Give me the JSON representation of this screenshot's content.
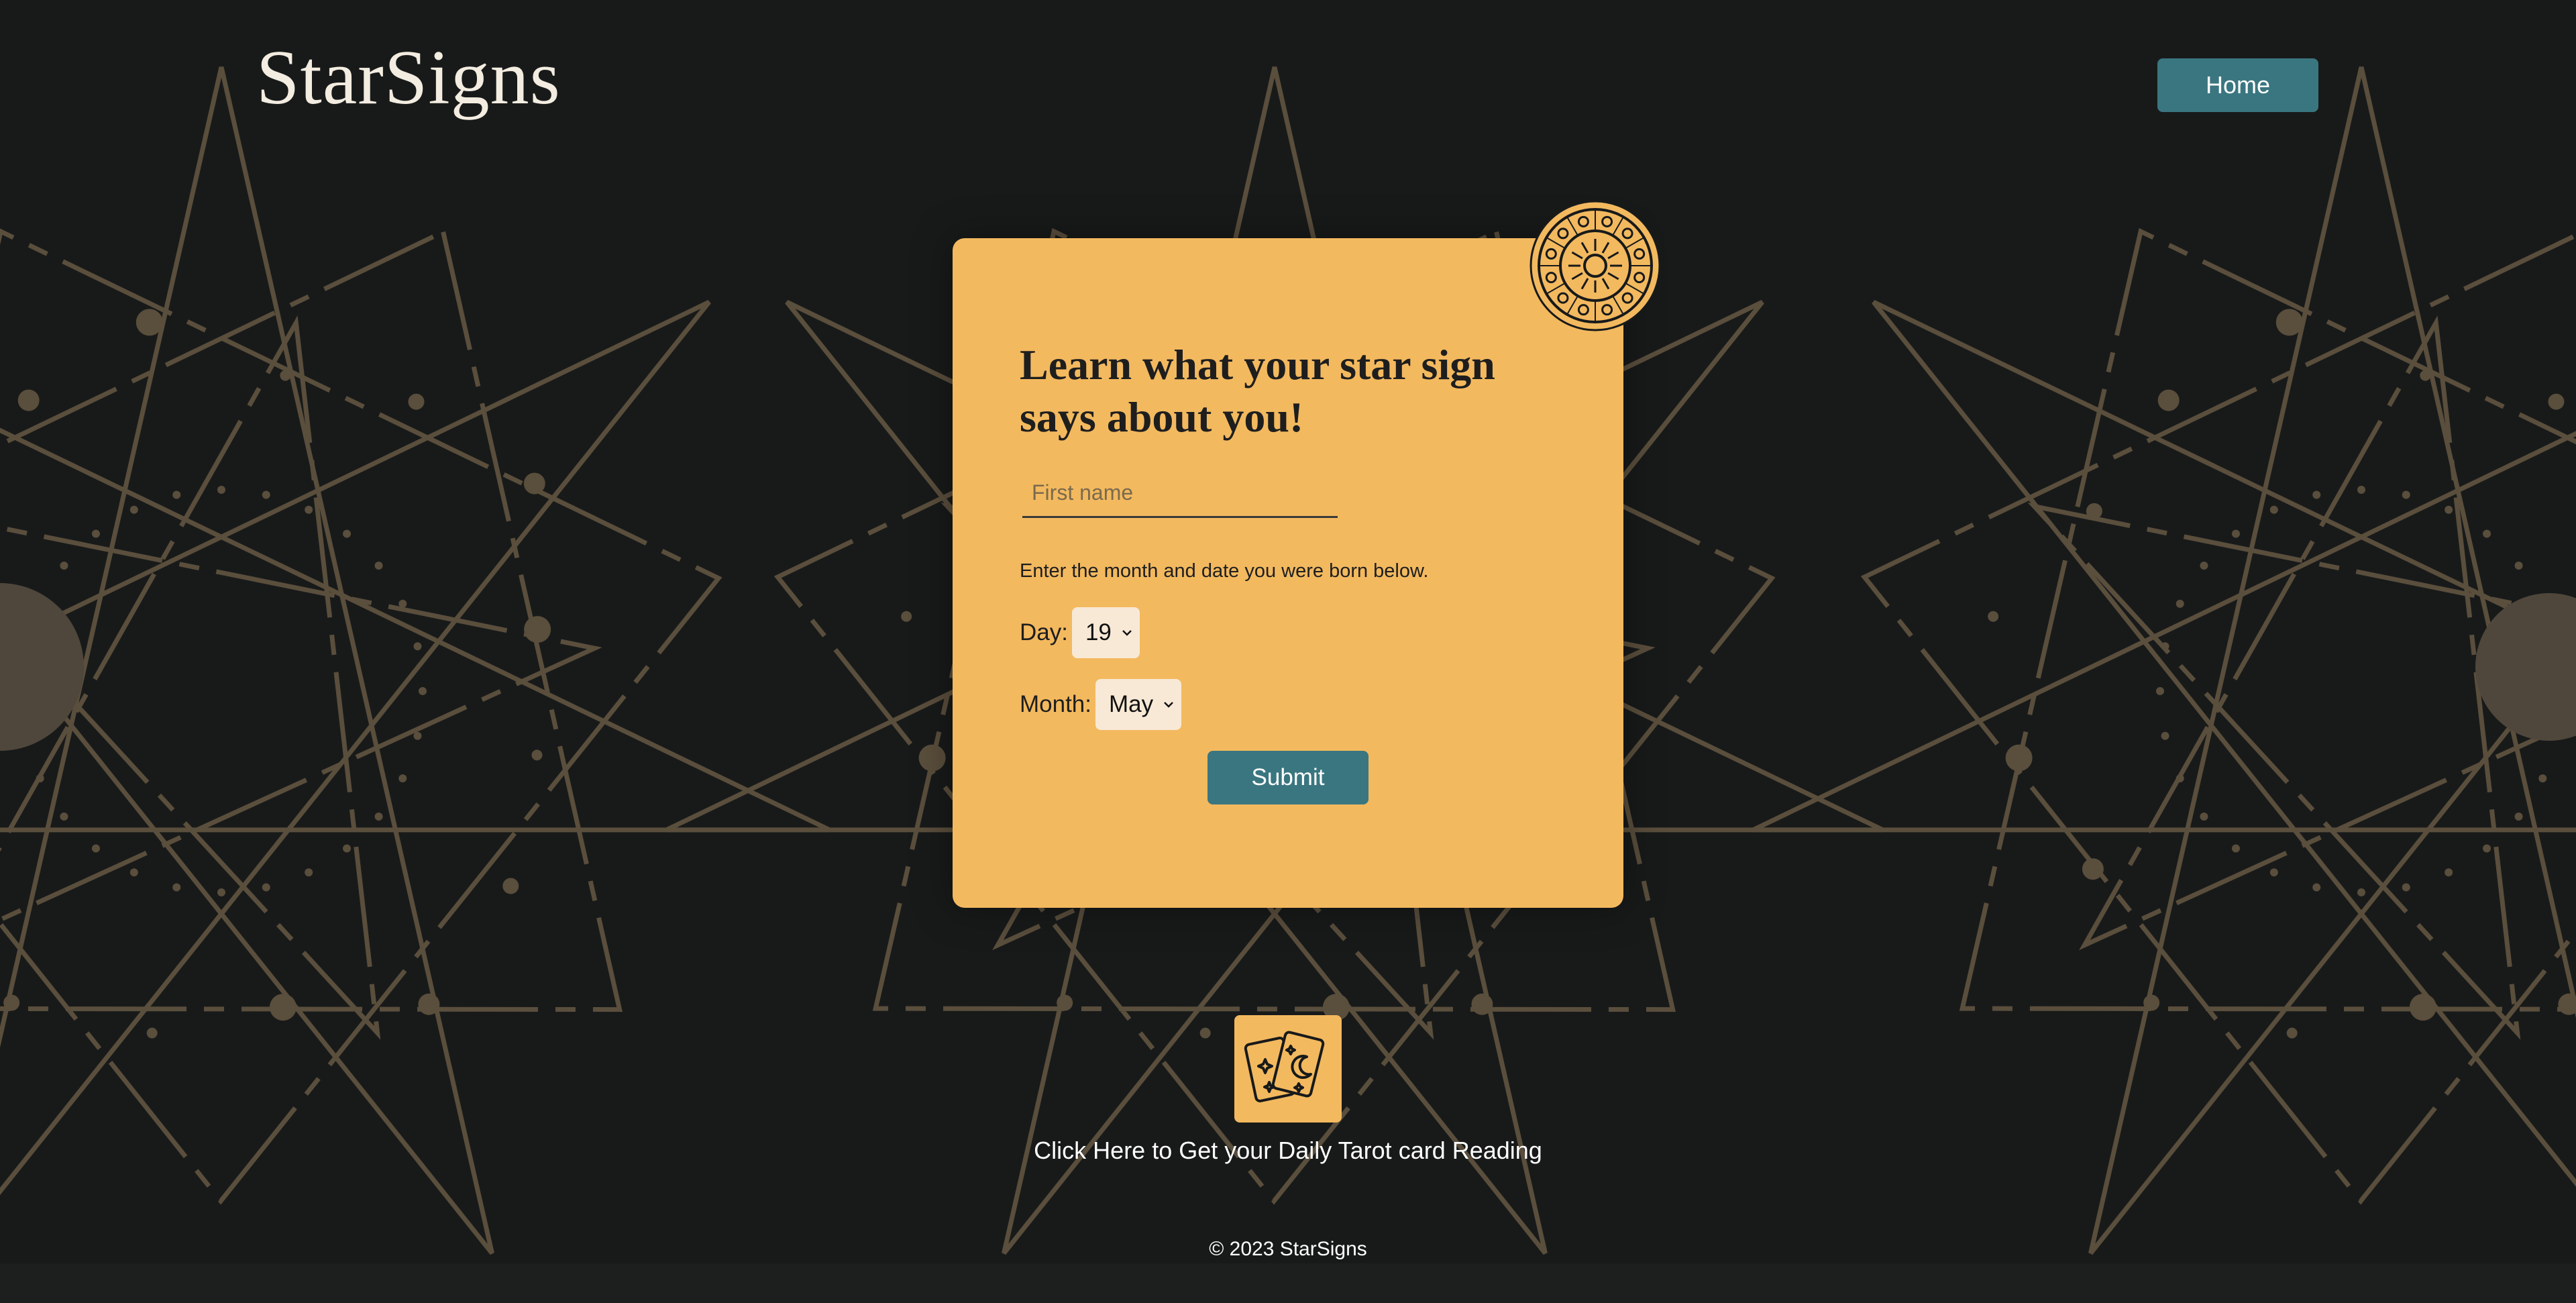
{
  "header": {
    "logo_text": "StarSigns",
    "nav_home_label": "Home"
  },
  "form": {
    "title": "Learn what your star sign says about you!",
    "first_name_placeholder": "First name",
    "first_name_value": "",
    "instructions": "Enter the month and date you were born below.",
    "day_label": "Day:",
    "day_value": "19",
    "month_label": "Month:",
    "month_value": "May",
    "submit_label": "Submit"
  },
  "tarot": {
    "icon": "tarot-cards-icon",
    "link_text": "Click Here to Get your Daily Tarot card Reading"
  },
  "footer": {
    "copyright": "© 2023 StarSigns"
  },
  "colors": {
    "background": "#181a1a",
    "accent": "#f3b95f",
    "button": "#3a7680",
    "pattern": "#5a4e3c"
  }
}
